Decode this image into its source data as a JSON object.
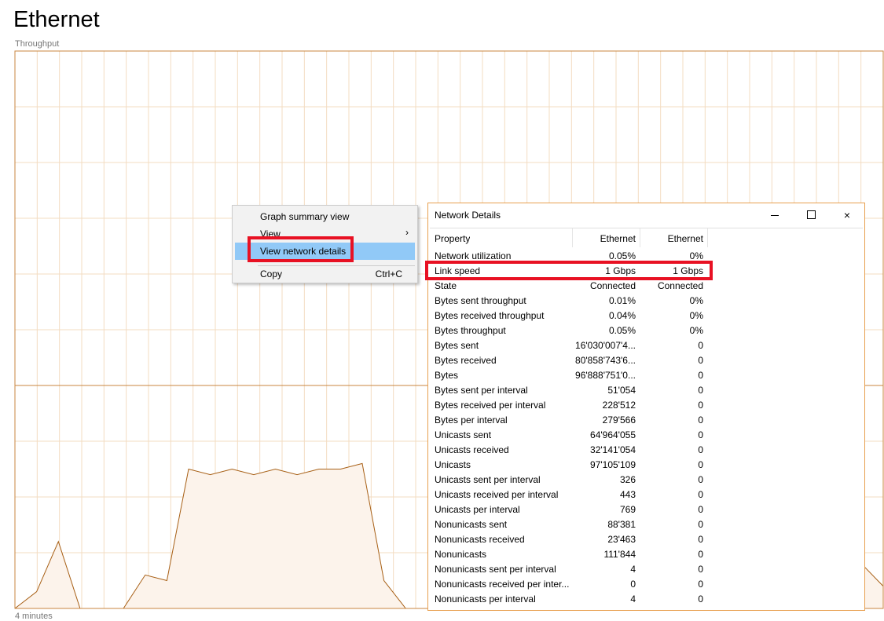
{
  "page": {
    "title": "Ethernet",
    "chart_label": "Throughput",
    "time_label": "4 minutes"
  },
  "colors": {
    "grid": "#f3dcc2",
    "border": "#c8853f",
    "line": "#a75f15",
    "fill": "#fcf3eb",
    "menu_highlight": "#91c9f7",
    "red_box": "#e81123"
  },
  "context_menu": {
    "items": [
      {
        "label": "Graph summary view",
        "shortcut": "",
        "has_submenu": false,
        "highlighted": false
      },
      {
        "label": "View",
        "shortcut": "",
        "has_submenu": true,
        "highlighted": false
      },
      {
        "label": "View network details",
        "shortcut": "",
        "has_submenu": false,
        "highlighted": true
      },
      {
        "label": "Copy",
        "shortcut": "Ctrl+C",
        "has_submenu": false,
        "highlighted": false
      }
    ],
    "submenu_arrow": "›"
  },
  "network_details": {
    "title": "Network Details",
    "controls": {
      "minimize": "minimize-icon",
      "maximize": "maximize-icon",
      "close": "×"
    },
    "columns": [
      "Property",
      "Ethernet",
      "Ethernet"
    ],
    "rows": [
      [
        "Network utilization",
        "0.05%",
        "0%"
      ],
      [
        "Link speed",
        "1 Gbps",
        "1 Gbps"
      ],
      [
        "State",
        "Connected",
        "Connected"
      ],
      [
        "Bytes sent throughput",
        "0.01%",
        "0%"
      ],
      [
        "Bytes received throughput",
        "0.04%",
        "0%"
      ],
      [
        "Bytes throughput",
        "0.05%",
        "0%"
      ],
      [
        "Bytes sent",
        "16'030'007'4...",
        "0"
      ],
      [
        "Bytes received",
        "80'858'743'6...",
        "0"
      ],
      [
        "Bytes",
        "96'888'751'0...",
        "0"
      ],
      [
        "Bytes sent per interval",
        "51'054",
        "0"
      ],
      [
        "Bytes received per interval",
        "228'512",
        "0"
      ],
      [
        "Bytes per interval",
        "279'566",
        "0"
      ],
      [
        "Unicasts sent",
        "64'964'055",
        "0"
      ],
      [
        "Unicasts received",
        "32'141'054",
        "0"
      ],
      [
        "Unicasts",
        "97'105'109",
        "0"
      ],
      [
        "Unicasts sent per interval",
        "326",
        "0"
      ],
      [
        "Unicasts received per interval",
        "443",
        "0"
      ],
      [
        "Unicasts per interval",
        "769",
        "0"
      ],
      [
        "Nonunicasts sent",
        "88'381",
        "0"
      ],
      [
        "Nonunicasts received",
        "23'463",
        "0"
      ],
      [
        "Nonunicasts",
        "111'844",
        "0"
      ],
      [
        "Nonunicasts sent per interval",
        "4",
        "0"
      ],
      [
        "Nonunicasts received per inter...",
        "0",
        "0"
      ],
      [
        "Nonunicasts per interval",
        "4",
        "0"
      ]
    ],
    "highlighted_row": "Link speed"
  },
  "chart_data": {
    "type": "area",
    "title": "Throughput",
    "xlabel": "4 minutes",
    "ylim": [
      0,
      100
    ],
    "grid": true,
    "series": [
      {
        "values": [
          0,
          3,
          12,
          0,
          0,
          0,
          6,
          5,
          25,
          24,
          25,
          24,
          25,
          24,
          25,
          25,
          26,
          5,
          0,
          0,
          0,
          0,
          0,
          0,
          0,
          0,
          0,
          0,
          0,
          0,
          0,
          0,
          0,
          0,
          0,
          0,
          0,
          0,
          0,
          8,
          4
        ]
      }
    ]
  }
}
